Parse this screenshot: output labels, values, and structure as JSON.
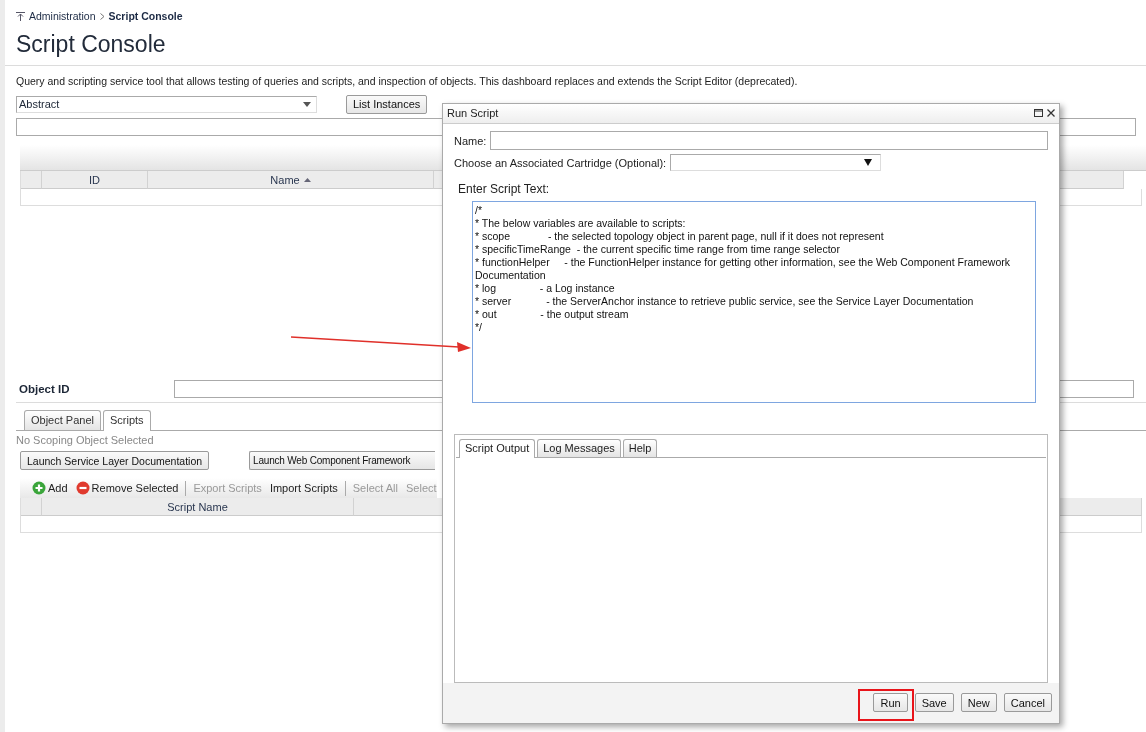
{
  "breadcrumb": {
    "parent": "Administration",
    "current": "Script Console"
  },
  "title": "Script Console",
  "description": "Query and scripting service tool that allows testing of queries and scripts, and inspection of objects. This dashboard replaces and extends the Script Editor (deprecated).",
  "type_select": {
    "value": "Abstract"
  },
  "list_button": "List Instances",
  "instances_table": {
    "columns": [
      {
        "label": "ID",
        "sorted": false
      },
      {
        "label": "Name",
        "sorted": true
      }
    ]
  },
  "object_id": {
    "label": "Object ID"
  },
  "tabs": [
    {
      "label": "Object Panel",
      "selected": false
    },
    {
      "label": "Scripts",
      "selected": true
    }
  ],
  "scope_note": "No Scoping Object Selected",
  "launch_buttons": [
    "Launch Service Layer Documentation",
    "Launch Web Component Framework"
  ],
  "toolbar": [
    [
      {
        "label": "Add",
        "kind": "add",
        "disabled": false
      },
      {
        "label": "Remove Selected",
        "kind": "remove",
        "disabled": false
      }
    ],
    [
      {
        "label": "Export Scripts",
        "kind": "text",
        "disabled": true
      },
      {
        "label": "Import Scripts",
        "kind": "text",
        "disabled": false
      }
    ],
    [
      {
        "label": "Select All",
        "kind": "text",
        "disabled": true
      },
      {
        "label": "Select",
        "kind": "text",
        "disabled": true
      }
    ]
  ],
  "scripts_table": {
    "columns": [
      "Script Name"
    ]
  },
  "dialog": {
    "title": "Run Script",
    "name_label": "Name:",
    "cartridge_label": "Choose an Associated Cartridge (Optional):",
    "script_label": "Enter Script Text:",
    "script_text": "/*\n* The below variables are available to scripts:\n* scope             - the selected topology object in parent page, null if it does not represent\n* specificTimeRange  - the current specific time range from time range selector\n* functionHelper     - the FunctionHelper instance for getting other information, see the Web Component Framework Documentation\n* log               - a Log instance\n* server            - the ServerAnchor instance to retrieve public service, see the Service Layer Documentation\n* out               - the output stream\n*/\n\n",
    "output_tabs": [
      {
        "label": "Script Output",
        "selected": true
      },
      {
        "label": "Log Messages",
        "selected": false
      },
      {
        "label": "Help",
        "selected": false
      }
    ],
    "buttons": [
      "Run",
      "Save",
      "New",
      "Cancel"
    ]
  }
}
